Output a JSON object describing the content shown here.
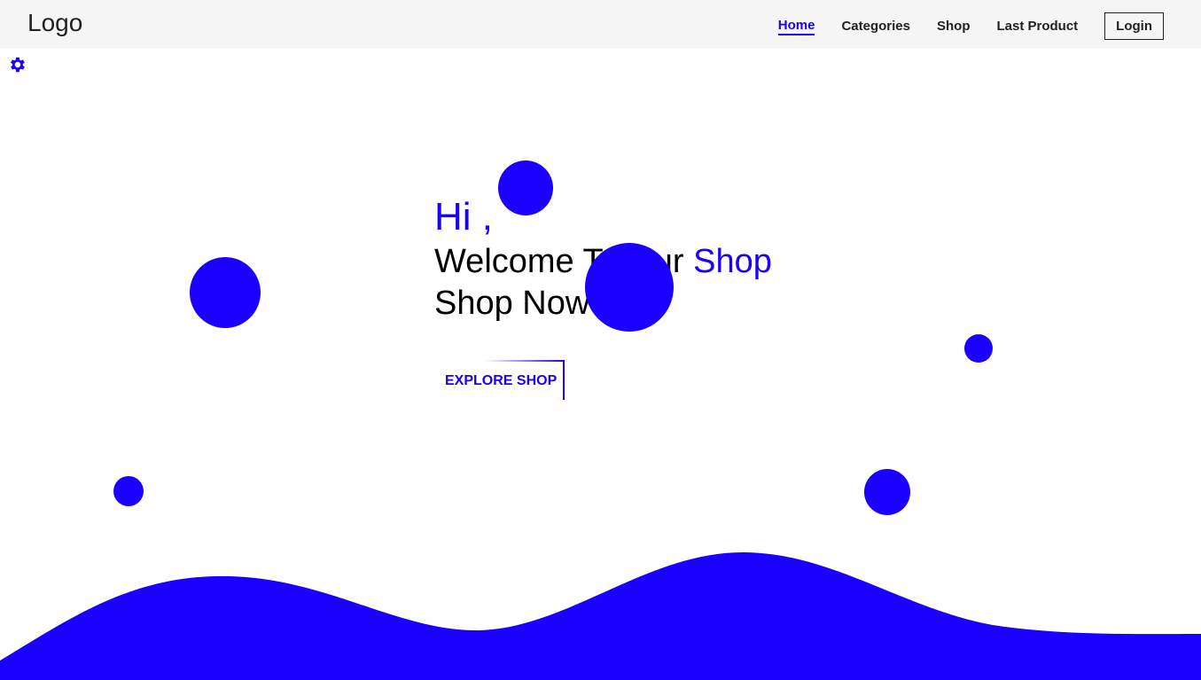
{
  "header": {
    "logo": "Logo",
    "nav": [
      {
        "label": "Home",
        "active": true
      },
      {
        "label": "Categories"
      },
      {
        "label": "Shop"
      },
      {
        "label": "Last Product"
      }
    ],
    "login_label": "Login"
  },
  "settings_icon": "gear-icon",
  "hero": {
    "greeting": "Hi ,",
    "line1_prefix": "Welcome To Our ",
    "line1_accent": "Shop",
    "line2_prefix": "Shop Now ",
    "line2_accent": ".",
    "button_label": "EXPLORE SHOP"
  },
  "colors": {
    "accent": "#1a00ff",
    "nav_bg": "#f5f5f5"
  }
}
